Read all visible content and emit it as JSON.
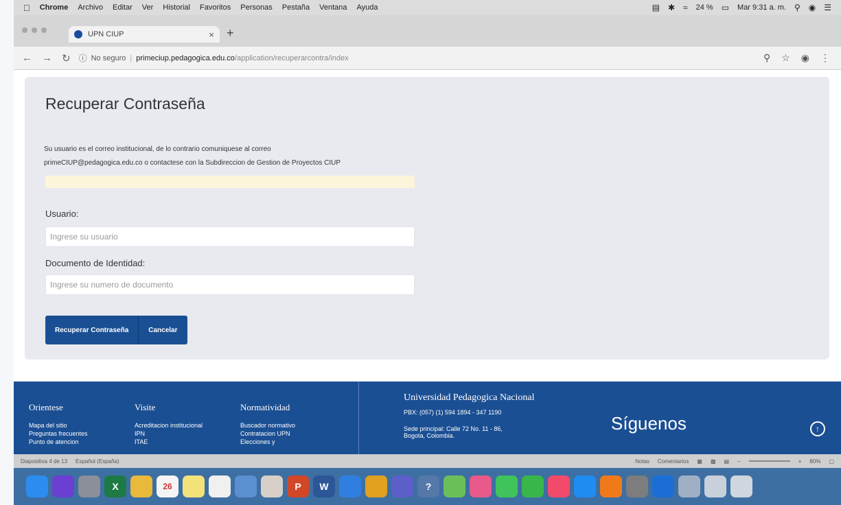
{
  "menubar": {
    "items": [
      "Chrome",
      "Archivo",
      "Editar",
      "Ver",
      "Historial",
      "Favoritos",
      "Personas",
      "Pestaña",
      "Ventana",
      "Ayuda"
    ],
    "battery": "24 %",
    "clock": "Mar 9:31 a. m."
  },
  "browser": {
    "tab_title": "UPN CIUP",
    "security_label": "No seguro",
    "url_host": "primeciup.pedagogica.edu.co",
    "url_path": "/application/recuperarcontra/index"
  },
  "form": {
    "title": "Recuperar Contraseña",
    "info_line1": "Su usuario es el correo institucional, de lo contrario comuniquese al correo",
    "info_line2": "primeCIUP@pedagogica.edu.co o contactese con la Subdireccion de Gestion de Proyectos CIUP",
    "user_label": "Usuario:",
    "user_placeholder": "Ingrese su usuario",
    "doc_label": "Documento de Identidad:",
    "doc_placeholder": "Ingrese su numero de documento",
    "submit_label": "Recuperar Contraseña",
    "cancel_label": "Cancelar"
  },
  "footer": {
    "col1": {
      "head": "Orientese",
      "links": [
        "Mapa del sitio",
        "Preguntas frecuentes",
        "Punto de atencion"
      ]
    },
    "col2": {
      "head": "Visite",
      "links": [
        "Acreditacion institucional",
        "IPN",
        "ITAE"
      ]
    },
    "col3": {
      "head": "Normatividad",
      "links": [
        "Buscador normativo",
        "Contratacion UPN",
        "Elecciones y"
      ]
    },
    "university": "Universidad Pedagogica Nacional",
    "pbx": "PBX: (057) (1) 594 1894 - 347 1190",
    "sede": "Sede principal: Calle 72 No. 11 - 86, Bogota, Colombia.",
    "follow": "Síguenos"
  },
  "statusbar": {
    "slide": "Diapositiva 4 de 13",
    "lang": "Español (España)",
    "notes": "Notas",
    "comments": "Comentarios",
    "zoom": "80%"
  },
  "dock": {
    "icons": [
      {
        "name": "finder-icon",
        "color": "#2d8cf0"
      },
      {
        "name": "siri-icon",
        "color": "#6a3fd1"
      },
      {
        "name": "launchpad-icon",
        "color": "#8a8f99"
      },
      {
        "name": "excel-icon",
        "color": "#1d7a44",
        "label": "X"
      },
      {
        "name": "notes-app-icon",
        "color": "#e8b93a"
      },
      {
        "name": "calendar-icon",
        "color": "#f4f4f4",
        "label": "26"
      },
      {
        "name": "stickies-icon",
        "color": "#f3e27a"
      },
      {
        "name": "file-icon",
        "color": "#f0f0f0"
      },
      {
        "name": "preview-icon",
        "color": "#5b8fd0"
      },
      {
        "name": "photos-icon",
        "color": "#d8d0c8"
      },
      {
        "name": "powerpoint-icon",
        "color": "#d24726",
        "label": "P"
      },
      {
        "name": "word-icon",
        "color": "#2b5797",
        "label": "W"
      },
      {
        "name": "safari-icon",
        "color": "#2f7fe0"
      },
      {
        "name": "chrome-icon",
        "color": "#e0a020"
      },
      {
        "name": "teams-icon",
        "color": "#5b5fc7"
      },
      {
        "name": "help-icon",
        "color": "#5478a8",
        "label": "?"
      },
      {
        "name": "maps-icon",
        "color": "#6bbf59"
      },
      {
        "name": "photos-color-icon",
        "color": "#e85a8a"
      },
      {
        "name": "messages-icon",
        "color": "#3fc35a"
      },
      {
        "name": "facetime-icon",
        "color": "#39b54a"
      },
      {
        "name": "music-icon",
        "color": "#f24a6a"
      },
      {
        "name": "appstore-icon",
        "color": "#1f8cf2"
      },
      {
        "name": "firefox-icon",
        "color": "#f07a1a"
      },
      {
        "name": "settings-icon",
        "color": "#7d7d7d"
      },
      {
        "name": "onedrive-icon",
        "color": "#1b6ed6"
      },
      {
        "name": "airdrop-icon",
        "color": "#a0b0c4"
      },
      {
        "name": "downloads-icon",
        "color": "#c8d0dc"
      },
      {
        "name": "trash-icon",
        "color": "#cfd6de"
      }
    ]
  }
}
